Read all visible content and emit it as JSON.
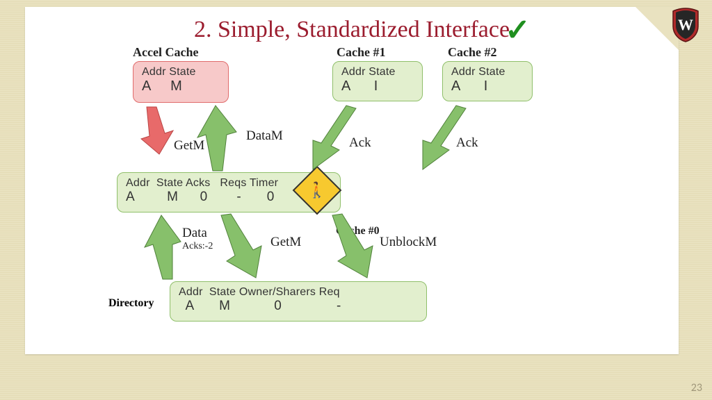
{
  "title": "2. Simple, Standardized Interface",
  "page_num": "23",
  "labels": {
    "accel": "Accel Cache",
    "cache1": "Cache #1",
    "cache2": "Cache #2",
    "cache0": "Cache #0",
    "directory": "Directory"
  },
  "boxes": {
    "accel": {
      "hdr": "Addr State",
      "addr": "A",
      "state": "M"
    },
    "cache1": {
      "hdr": "Addr State",
      "addr": "A",
      "state": "I"
    },
    "cache2": {
      "hdr": "Addr State",
      "addr": "A",
      "state": "I"
    },
    "mid": {
      "hdr": "Addr  State Acks   Reqs Timer",
      "row": "A         M      0        -       0"
    },
    "dir": {
      "hdr": "Addr  State Owner/Sharers Req",
      "row": "  A       M            0               -"
    }
  },
  "messages": {
    "getm1": "GetM",
    "dataM": "DataM",
    "ack1": "Ack",
    "ack2": "Ack",
    "data": "Data",
    "acks2": "Acks:-2",
    "getm2": "GetM",
    "unblockM": "UnblockM"
  }
}
